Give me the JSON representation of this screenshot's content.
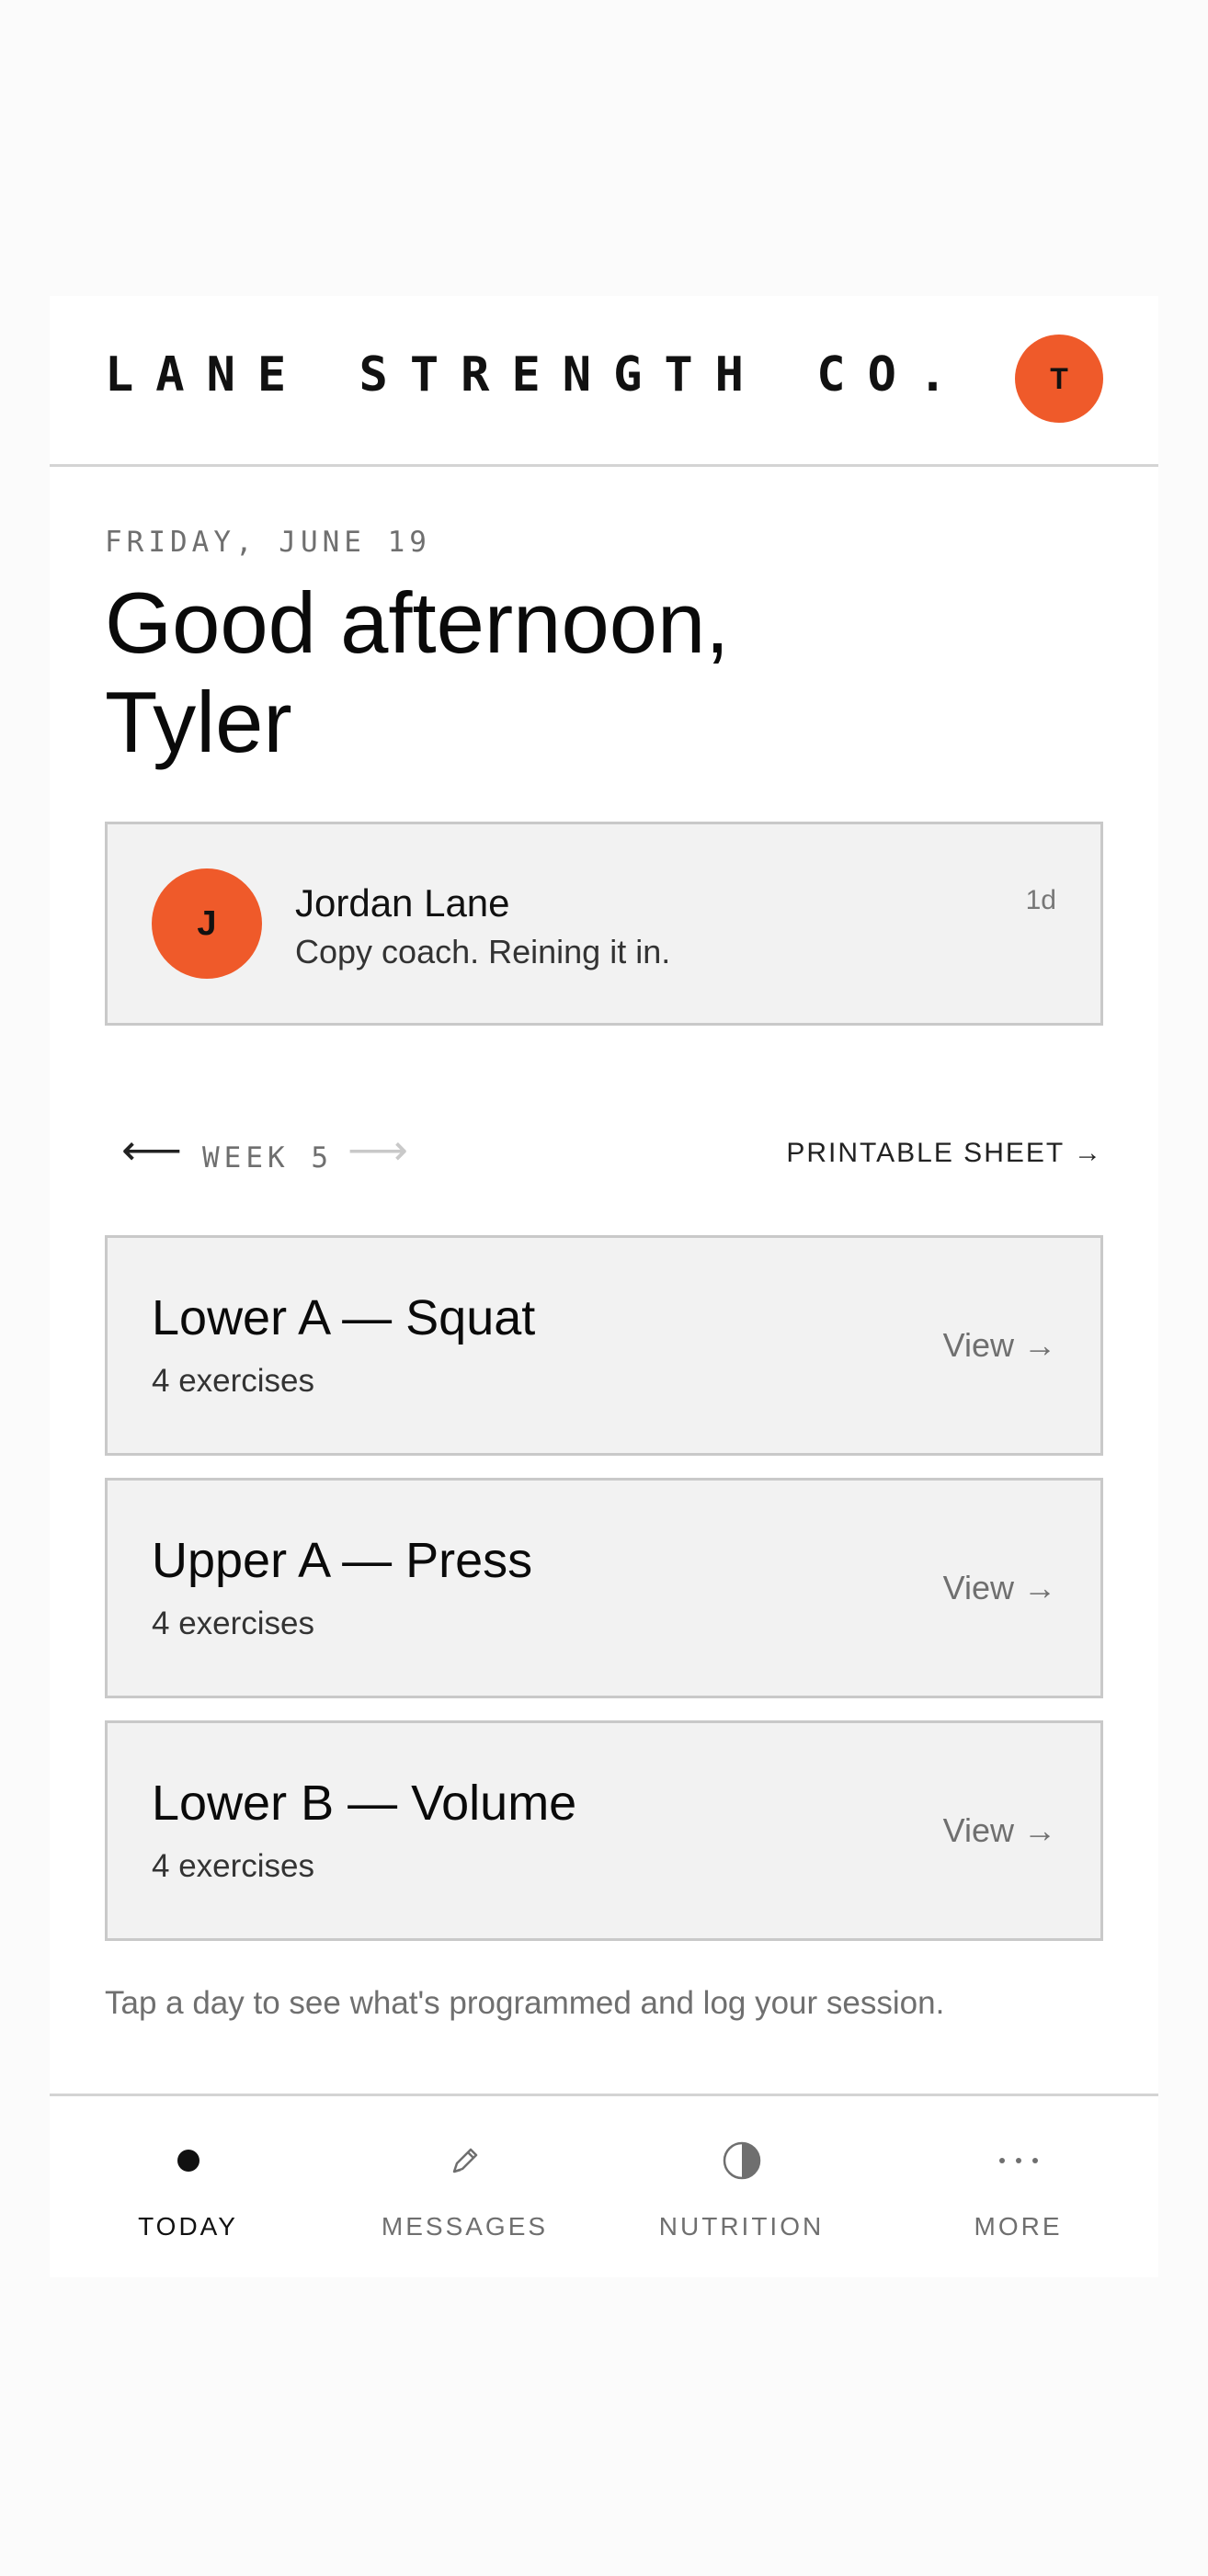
{
  "header": {
    "brand": "LANE STRENGTH CO.",
    "avatar_initial": "T"
  },
  "greeting": {
    "date": "FRIDAY, JUNE 19",
    "line1": "Good afternoon,",
    "line2": "Tyler"
  },
  "message": {
    "avatar_initial": "J",
    "sender": "Jordan Lane",
    "text": "Copy coach. Reining it in.",
    "time": "1d"
  },
  "week_nav": {
    "prev_icon": "arrow-left-icon",
    "label": "WEEK 5",
    "next_icon": "arrow-right-icon",
    "printable": "PRINTABLE SHEET →"
  },
  "workouts": [
    {
      "title": "Lower A — Squat",
      "subtitle": "4 exercises",
      "action": "View →"
    },
    {
      "title": "Upper A — Press",
      "subtitle": "4 exercises",
      "action": "View →"
    },
    {
      "title": "Lower B — Volume",
      "subtitle": "4 exercises",
      "action": "View →"
    }
  ],
  "hint": "Tap a day to see what's programmed and log your session.",
  "bottom_nav": [
    {
      "label": "TODAY",
      "icon": "dot-icon",
      "active": true
    },
    {
      "label": "MESSAGES",
      "icon": "pencil-icon",
      "active": false
    },
    {
      "label": "NUTRITION",
      "icon": "half-circle-icon",
      "active": false
    },
    {
      "label": "MORE",
      "icon": "ellipsis-icon",
      "active": false
    }
  ],
  "colors": {
    "accent": "#ef5a2a",
    "card_bg": "#f2f2f2",
    "border": "#c9c9c9",
    "muted_text": "#6f6f6f"
  }
}
